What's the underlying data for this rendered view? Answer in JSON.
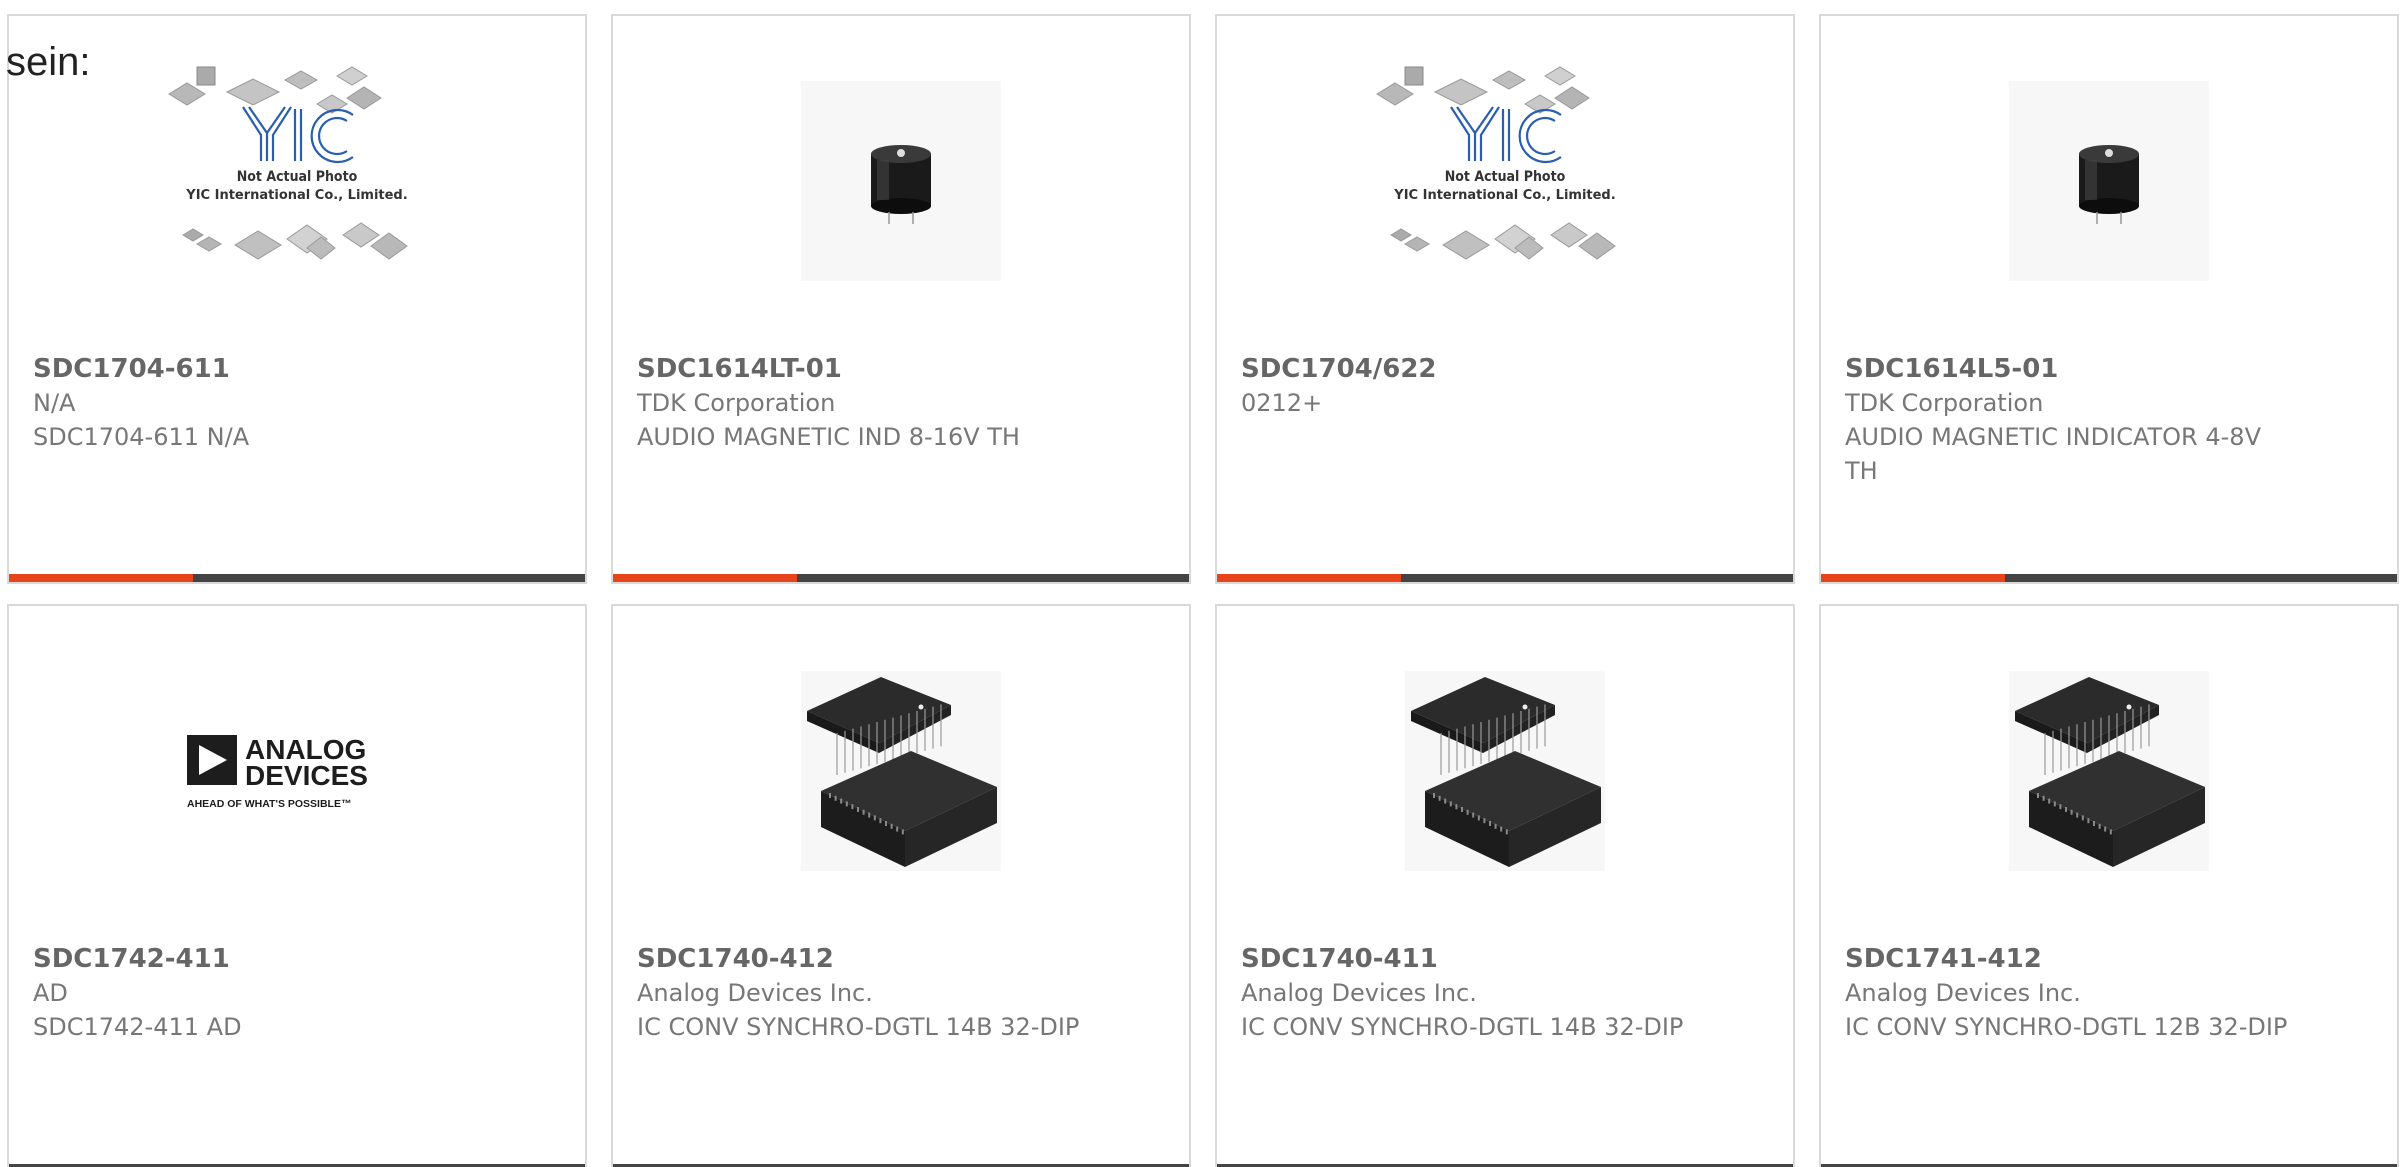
{
  "intro_text": "sein:",
  "colors": {
    "accent": "#e8441a",
    "bar": "#444444",
    "border": "#d9d9d9"
  },
  "products": [
    {
      "part": "SDC1704-611",
      "manufacturer": "N/A",
      "description": "SDC1704-611 N/A",
      "image": "yic-placeholder",
      "placeholder_line1": "Not Actual Photo",
      "placeholder_line2": "YIC International Co., Limited.",
      "progress": 0.32
    },
    {
      "part": "SDC1614LT-01",
      "manufacturer": "TDK Corporation",
      "description": "AUDIO MAGNETIC IND 8-16V TH",
      "image": "buzzer-photo",
      "progress": 0.32
    },
    {
      "part": "SDC1704/622",
      "manufacturer": "0212+",
      "description": "",
      "image": "yic-placeholder",
      "placeholder_line1": "Not Actual Photo",
      "placeholder_line2": "YIC International Co., Limited.",
      "progress": 0.32
    },
    {
      "part": "SDC1614L5-01",
      "manufacturer": "TDK Corporation",
      "description": "AUDIO MAGNETIC INDICATOR 4-8V TH",
      "image": "buzzer-photo",
      "progress": 0.32
    },
    {
      "part": "SDC1742-411",
      "manufacturer": "AD",
      "description": "SDC1742-411 AD",
      "image": "analog-devices-logo",
      "logo_line1": "ANALOG",
      "logo_line2": "DEVICES",
      "logo_tagline": "AHEAD OF WHAT'S POSSIBLE™",
      "progress": 0
    },
    {
      "part": "SDC1740-412",
      "manufacturer": "Analog Devices Inc.",
      "description": "IC CONV SYNCHRO-DGTL 14B 32-DIP",
      "image": "dip-module-photo",
      "progress": 0
    },
    {
      "part": "SDC1740-411",
      "manufacturer": "Analog Devices Inc.",
      "description": "IC CONV SYNCHRO-DGTL 14B 32-DIP",
      "image": "dip-module-photo",
      "progress": 0
    },
    {
      "part": "SDC1741-412",
      "manufacturer": "Analog Devices Inc.",
      "description": "IC CONV SYNCHRO-DGTL 12B 32-DIP",
      "image": "dip-module-photo",
      "progress": 0
    }
  ]
}
